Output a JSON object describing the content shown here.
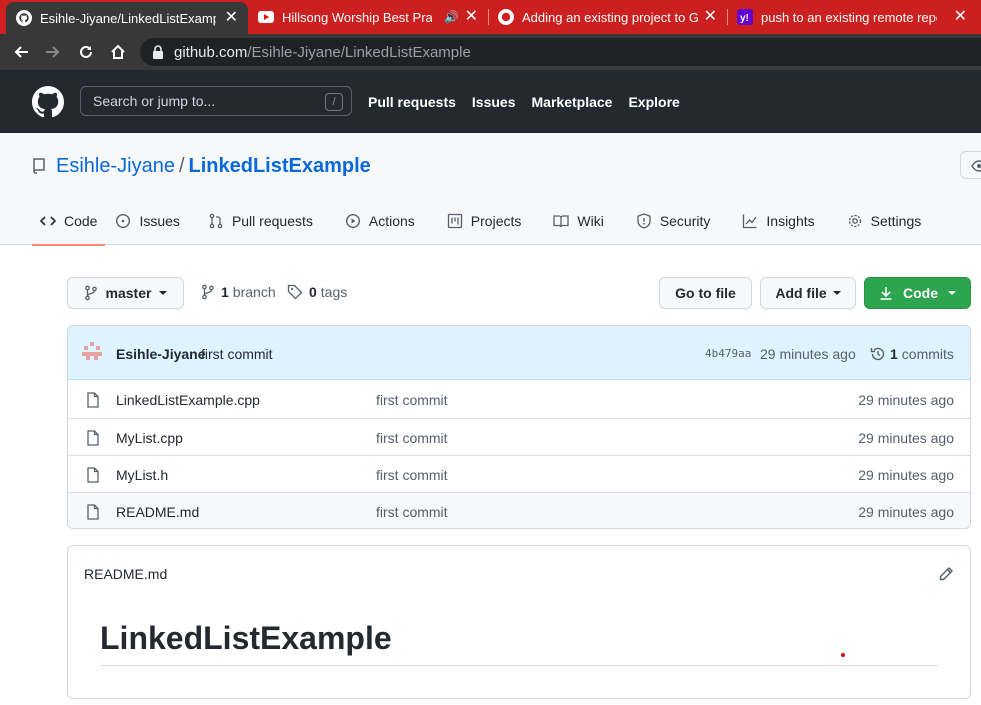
{
  "browser": {
    "tabs": [
      {
        "title": "Esihle-Jiyane/LinkedListExample",
        "icon": "github-icon",
        "active": true
      },
      {
        "title": "Hillsong Worship Best Praise",
        "icon": "youtube-icon",
        "active": false
      },
      {
        "title": "Adding an existing project to GitH",
        "icon": "github-icon",
        "active": false
      },
      {
        "title": "push to an existing remote repos",
        "icon": "yahoo-icon",
        "active": false
      }
    ],
    "url_domain": "github.com",
    "url_path": "/Esihle-Jiyane/LinkedListExample",
    "tabstrip_color": "#cc1f1f"
  },
  "header": {
    "search_placeholder": "Search or jump to...",
    "search_shortcut": "/",
    "nav": [
      "Pull requests",
      "Issues",
      "Marketplace",
      "Explore"
    ]
  },
  "repo": {
    "owner": "Esihle-Jiyane",
    "separator": "/",
    "name": "LinkedListExample",
    "tabs": [
      {
        "label": "Code",
        "icon": "code-icon",
        "selected": true
      },
      {
        "label": "Issues",
        "icon": "issue-icon"
      },
      {
        "label": "Pull requests",
        "icon": "pull-request-icon"
      },
      {
        "label": "Actions",
        "icon": "play-icon"
      },
      {
        "label": "Projects",
        "icon": "project-icon"
      },
      {
        "label": "Wiki",
        "icon": "book-icon"
      },
      {
        "label": "Security",
        "icon": "shield-icon"
      },
      {
        "label": "Insights",
        "icon": "graph-icon"
      },
      {
        "label": "Settings",
        "icon": "gear-icon"
      }
    ]
  },
  "branchbar": {
    "branch": "master",
    "branch_count": "1",
    "branch_label": "branch",
    "tag_count": "0",
    "tag_label": "tags",
    "go_to_file": "Go to file",
    "add_file": "Add file",
    "code": "Code"
  },
  "commit": {
    "author": "Esihle-Jiyane",
    "message": "first commit",
    "sha": "4b479aa",
    "time": "29 minutes ago",
    "count": "1",
    "count_label": "commits"
  },
  "files": [
    {
      "name": "LinkedListExample.cpp",
      "message": "first commit",
      "age": "29 minutes ago"
    },
    {
      "name": "MyList.cpp",
      "message": "first commit",
      "age": "29 minutes ago"
    },
    {
      "name": "MyList.h",
      "message": "first commit",
      "age": "29 minutes ago"
    },
    {
      "name": "README.md",
      "message": "first commit",
      "age": "29 minutes ago"
    }
  ],
  "readme": {
    "filename": "README.md",
    "heading": "LinkedListExample"
  },
  "colors": {
    "link": "#0969da",
    "green": "#2da44e",
    "header_bg": "#24292f",
    "selected_underline": "#fd8c73"
  }
}
